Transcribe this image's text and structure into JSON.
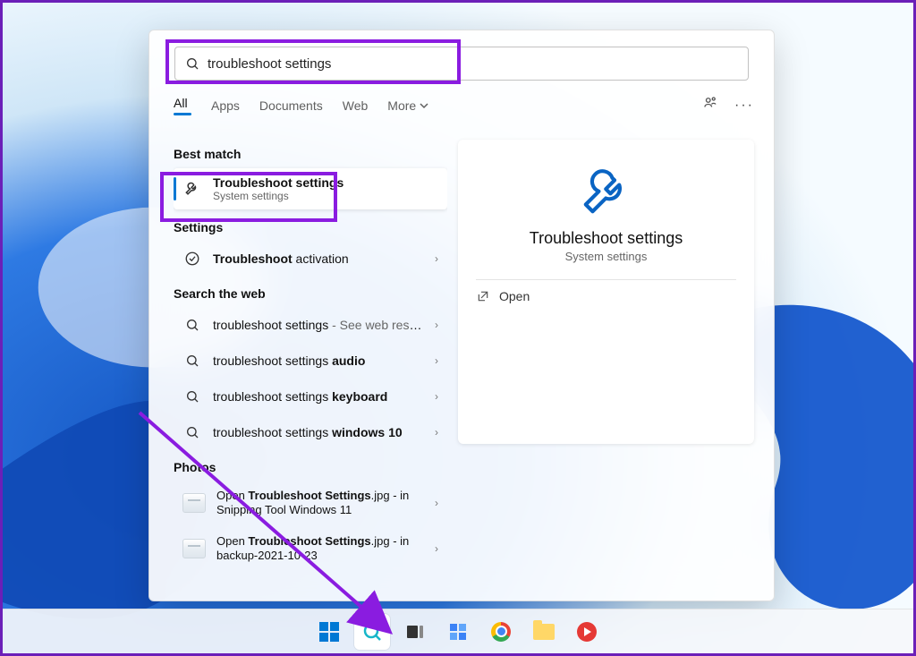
{
  "search": {
    "query": "troubleshoot settings"
  },
  "tabs": {
    "items": [
      {
        "label": "All"
      },
      {
        "label": "Apps"
      },
      {
        "label": "Documents"
      },
      {
        "label": "Web"
      },
      {
        "label": "More"
      }
    ]
  },
  "sections": {
    "best_match": "Best match",
    "settings": "Settings",
    "search_web": "Search the web",
    "photos": "Photos"
  },
  "best_match": {
    "title": "Troubleshoot settings",
    "subtitle": "System settings"
  },
  "settings_results": [
    {
      "prefix": "Troubleshoot",
      "suffix": " activation"
    }
  ],
  "web_results": [
    {
      "term": "troubleshoot settings",
      "bold": "",
      "suffix": " - See web results"
    },
    {
      "term": "troubleshoot settings ",
      "bold": "audio",
      "suffix": ""
    },
    {
      "term": "troubleshoot settings ",
      "bold": "keyboard",
      "suffix": ""
    },
    {
      "term": "troubleshoot settings ",
      "bold": "windows 10",
      "suffix": ""
    }
  ],
  "photo_results": [
    {
      "prefix": "Open ",
      "bold": "Troubleshoot Settings",
      "suffix": ".jpg - in Snipping Tool Windows 11"
    },
    {
      "prefix": "Open ",
      "bold": "Troubleshoot Settings",
      "suffix": ".jpg - in backup-2021-10-23"
    }
  ],
  "preview": {
    "title": "Troubleshoot settings",
    "subtitle": "System settings",
    "open": "Open"
  }
}
